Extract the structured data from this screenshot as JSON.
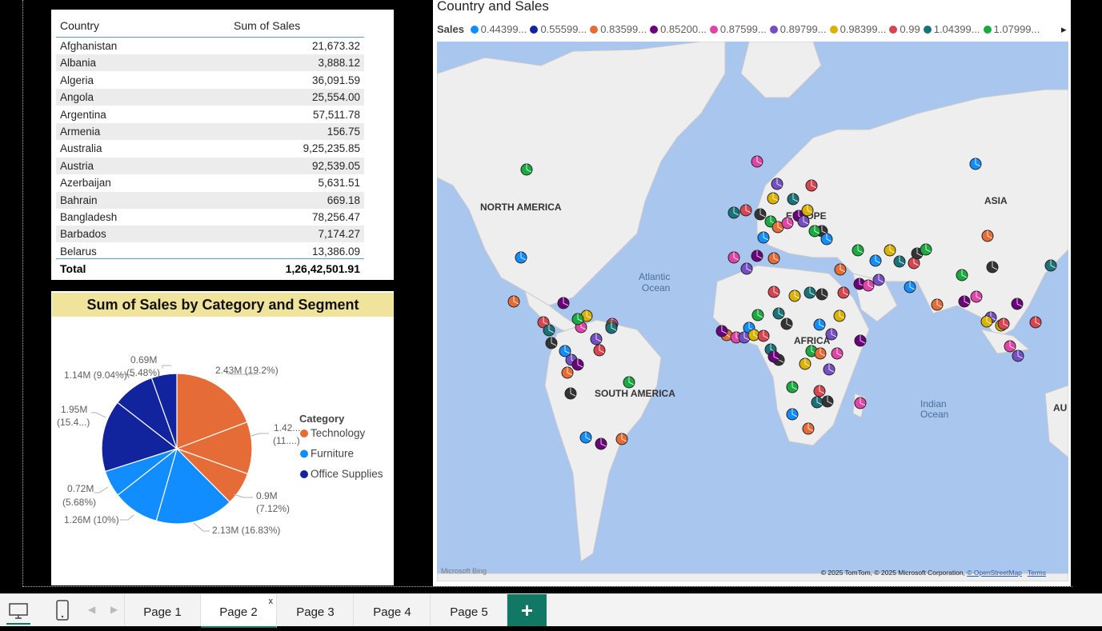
{
  "table": {
    "header": {
      "country": "Country",
      "sales": "Sum of Sales"
    },
    "rows": [
      {
        "country": "Afghanistan",
        "sales": "21,673.32"
      },
      {
        "country": "Albania",
        "sales": "3,888.12"
      },
      {
        "country": "Algeria",
        "sales": "36,091.59"
      },
      {
        "country": "Angola",
        "sales": "25,554.00"
      },
      {
        "country": "Argentina",
        "sales": "57,511.78"
      },
      {
        "country": "Armenia",
        "sales": "156.75"
      },
      {
        "country": "Australia",
        "sales": "9,25,235.85"
      },
      {
        "country": "Austria",
        "sales": "92,539.05"
      },
      {
        "country": "Azerbaijan",
        "sales": "5,631.51"
      },
      {
        "country": "Bahrain",
        "sales": "669.18"
      },
      {
        "country": "Bangladesh",
        "sales": "78,256.47"
      },
      {
        "country": "Barbados",
        "sales": "7,174.27"
      },
      {
        "country": "Belarus",
        "sales": "13,386.09"
      }
    ],
    "total_label": "Total",
    "total_value": "1,26,42,501.91"
  },
  "pie": {
    "title": "Sum of Sales by Category and Segment",
    "legend_title": "Category",
    "legend": [
      {
        "name": "Technology",
        "color": "#e66c37"
      },
      {
        "name": "Furniture",
        "color": "#118dff"
      },
      {
        "name": "Office Supplies",
        "color": "#12239e"
      }
    ],
    "labels": {
      "l1a": "2.43M (19.2%)",
      "l2a": "1.42...",
      "l2b": "(11....)",
      "l3a": "0.9M",
      "l3b": "(7.12%)",
      "l4a": "2.13M (16.83%)",
      "l5a": "1.26M (10%)",
      "l6a": "0.72M",
      "l6b": "(5.68%)",
      "l7a": "1.95M",
      "l7b": "(15.4...)",
      "l8a": "1.14M (9.04%)",
      "l9a": "0.69M",
      "l9b": "(5.48%)"
    }
  },
  "chart_data": {
    "type": "pie",
    "title": "Sum of Sales by Category and Segment",
    "legend_title": "Category",
    "slices": [
      {
        "category": "Technology",
        "label": "2.43M (19.2%)",
        "value": 2.43,
        "percent": 19.2
      },
      {
        "category": "Technology",
        "label": "1.42M (11.2%)",
        "value": 1.42,
        "percent": 11.23
      },
      {
        "category": "Technology",
        "label": "0.9M (7.12%)",
        "value": 0.9,
        "percent": 7.12
      },
      {
        "category": "Furniture",
        "label": "2.13M (16.83%)",
        "value": 2.13,
        "percent": 16.83
      },
      {
        "category": "Furniture",
        "label": "1.26M (10%)",
        "value": 1.26,
        "percent": 10.0
      },
      {
        "category": "Furniture",
        "label": "0.72M (5.68%)",
        "value": 0.72,
        "percent": 5.68
      },
      {
        "category": "Office Supplies",
        "label": "1.95M (15.4%)",
        "value": 1.95,
        "percent": 15.4
      },
      {
        "category": "Office Supplies",
        "label": "1.14M (9.04%)",
        "value": 1.14,
        "percent": 9.04
      },
      {
        "category": "Office Supplies",
        "label": "0.69M (5.48%)",
        "value": 0.69,
        "percent": 5.48
      }
    ],
    "unit": "M"
  },
  "map": {
    "title": "Country and Sales",
    "legend_label": "Sales",
    "legend_items": [
      {
        "text": "0.44399...",
        "color": "#118dff"
      },
      {
        "text": "0.55599...",
        "color": "#12239e"
      },
      {
        "text": "0.83599...",
        "color": "#e66c37"
      },
      {
        "text": "0.85200...",
        "color": "#6b007b"
      },
      {
        "text": "0.87599...",
        "color": "#e044a7"
      },
      {
        "text": "0.89799...",
        "color": "#744ec2"
      },
      {
        "text": "0.98399...",
        "color": "#d9b300"
      },
      {
        "text": "0.99",
        "color": "#d64550"
      },
      {
        "text": "1.04399...",
        "color": "#197278"
      },
      {
        "text": "1.07999...",
        "color": "#1aab40"
      }
    ],
    "labels": {
      "north_america": "NORTH AMERICA",
      "south_america": "SOUTH AMERICA",
      "europe": "EUROPE",
      "africa": "AFRICA",
      "asia": "ASIA",
      "au": "AU",
      "atlantic1": "Atlantic",
      "atlantic2": "Ocean",
      "indian1": "Indian",
      "indian2": "Ocean"
    },
    "attribution": "© 2025 TomTom, © 2025 Microsoft Corporation,",
    "osm": "© OpenStreetMap",
    "terms": "Terms",
    "bing": "Microsoft Bing"
  },
  "tabs": [
    {
      "label": "Page 1"
    },
    {
      "label": "Page 2",
      "active": true
    },
    {
      "label": "Page 3"
    },
    {
      "label": "Page 4"
    },
    {
      "label": "Page 5"
    }
  ],
  "tab_close": "x",
  "add_tab": "+"
}
